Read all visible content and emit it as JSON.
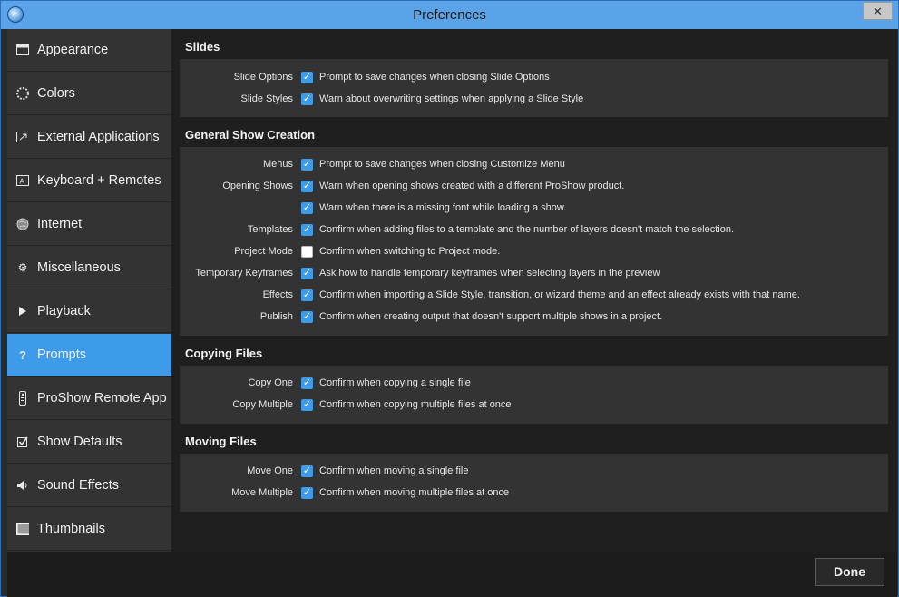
{
  "window": {
    "title": "Preferences",
    "close_glyph": "✕"
  },
  "sidebar": {
    "items": [
      {
        "label": "Appearance",
        "icon": "window-icon"
      },
      {
        "label": "Colors",
        "icon": "color-wheel-icon"
      },
      {
        "label": "External Applications",
        "icon": "external-app-icon"
      },
      {
        "label": "Keyboard + Remotes",
        "icon": "keyboard-icon"
      },
      {
        "label": "Internet",
        "icon": "globe-icon"
      },
      {
        "label": "Miscellaneous",
        "icon": "gear-icon"
      },
      {
        "label": "Playback",
        "icon": "play-icon"
      },
      {
        "label": "Prompts",
        "icon": "question-icon"
      },
      {
        "label": "ProShow Remote App",
        "icon": "remote-icon"
      },
      {
        "label": "Show Defaults",
        "icon": "checkbox-icon"
      },
      {
        "label": "Sound Effects",
        "icon": "speaker-icon"
      },
      {
        "label": "Thumbnails",
        "icon": "thumbnail-icon"
      }
    ],
    "active_index": 7
  },
  "sections": {
    "slides": {
      "title": "Slides",
      "rows": [
        {
          "label": "Slide Options",
          "checked": true,
          "text": "Prompt to save changes when closing Slide Options"
        },
        {
          "label": "Slide Styles",
          "checked": true,
          "text": "Warn about overwriting settings when applying a Slide Style"
        }
      ]
    },
    "general": {
      "title": "General Show Creation",
      "rows": [
        {
          "label": "Menus",
          "checked": true,
          "text": "Prompt to save changes when closing Customize Menu"
        },
        {
          "label": "Opening Shows",
          "checked": true,
          "text": "Warn when opening shows created with a different ProShow product."
        },
        {
          "label": "",
          "checked": true,
          "text": "Warn when there is a missing font while loading a show."
        },
        {
          "label": "Templates",
          "checked": true,
          "text": "Confirm when adding files to a template and the number of layers doesn't match the selection."
        },
        {
          "label": "Project Mode",
          "checked": false,
          "text": "Confirm when switching to Project mode."
        },
        {
          "label": "Temporary Keyframes",
          "checked": true,
          "text": "Ask how to handle temporary keyframes when selecting layers in the preview"
        },
        {
          "label": "Effects",
          "checked": true,
          "text": "Confirm when importing a Slide Style, transition, or wizard theme and an effect already exists with that name."
        },
        {
          "label": "Publish",
          "checked": true,
          "text": "Confirm when creating output that doesn't support multiple shows in a project."
        }
      ]
    },
    "copying": {
      "title": "Copying Files",
      "rows": [
        {
          "label": "Copy One",
          "checked": true,
          "text": "Confirm when copying a single file"
        },
        {
          "label": "Copy Multiple",
          "checked": true,
          "text": "Confirm when copying multiple files at once"
        }
      ]
    },
    "moving": {
      "title": "Moving Files",
      "rows": [
        {
          "label": "Move One",
          "checked": true,
          "text": "Confirm when moving a single file"
        },
        {
          "label": "Move Multiple",
          "checked": true,
          "text": "Confirm when moving multiple files at once"
        }
      ]
    }
  },
  "footer": {
    "done_label": "Done"
  },
  "colors": {
    "accent": "#3d9be9",
    "titlebar": "#5aa3e9",
    "panel": "#333333",
    "content_bg": "#1f1f1f"
  }
}
